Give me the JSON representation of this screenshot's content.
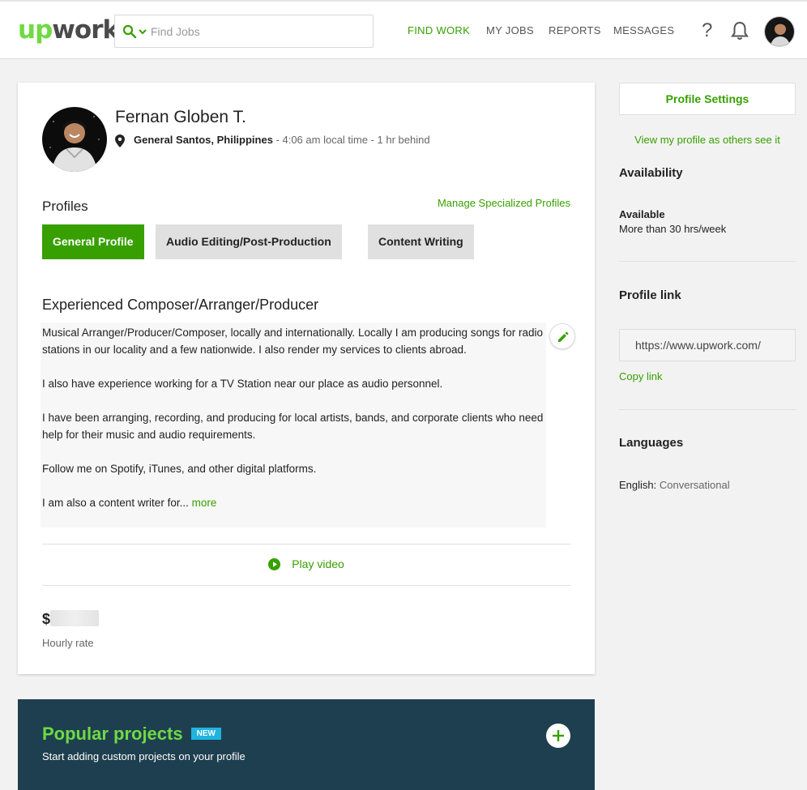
{
  "header": {
    "logo_up": "up",
    "logo_work": "work",
    "search_placeholder": "Find Jobs",
    "nav": [
      "FIND WORK",
      "MY JOBS",
      "REPORTS",
      "MESSAGES"
    ],
    "help_label": "?",
    "accent_color": "#37a000",
    "logo_color": "#6fda44"
  },
  "profile": {
    "name": "Fernan Globen T.",
    "location": "General Santos, Philippines",
    "local_time": " - 4:06 am local time - 1 hr behind",
    "profiles_heading": "Profiles",
    "manage_link": "Manage Specialized Profiles",
    "tabs": [
      "General Profile",
      "Audio Editing/Post-Production",
      "Content Writing"
    ],
    "title": "Experienced Composer/Arranger/Producer",
    "description": [
      "Musical Arranger/Producer/Composer, locally and internationally. Locally I am producing songs for radio stations in our locality and a few nationwide. I also render my services to clients abroad.",
      "I also have experience working for a TV Station near our place as audio personnel.",
      "I have been arranging, recording, and producing for local artists, bands, and corporate clients who need help for their music and audio requirements.",
      "Follow me on Spotify, iTunes, and other digital platforms.",
      "I am also a content writer for..."
    ],
    "more_link": "more",
    "play_video": "Play video",
    "rate_symbol": "$",
    "rate_label": "Hourly rate"
  },
  "popular": {
    "heading": "Popular projects",
    "badge": "NEW",
    "subtitle": "Start adding custom projects on your profile",
    "bg_color": "#1e3f4f",
    "badge_color": "#1fb4e0"
  },
  "sidebar": {
    "settings_button": "Profile Settings",
    "view_link": "View my profile as others see it",
    "availability_heading": "Availability",
    "availability_status": "Available",
    "availability_hours": "More than 30 hrs/week",
    "profile_link_heading": "Profile link",
    "profile_link_value": "https://www.upwork.com/",
    "copy_link": "Copy link",
    "languages_heading": "Languages",
    "language_name": "English:",
    "language_level": "Conversational"
  }
}
